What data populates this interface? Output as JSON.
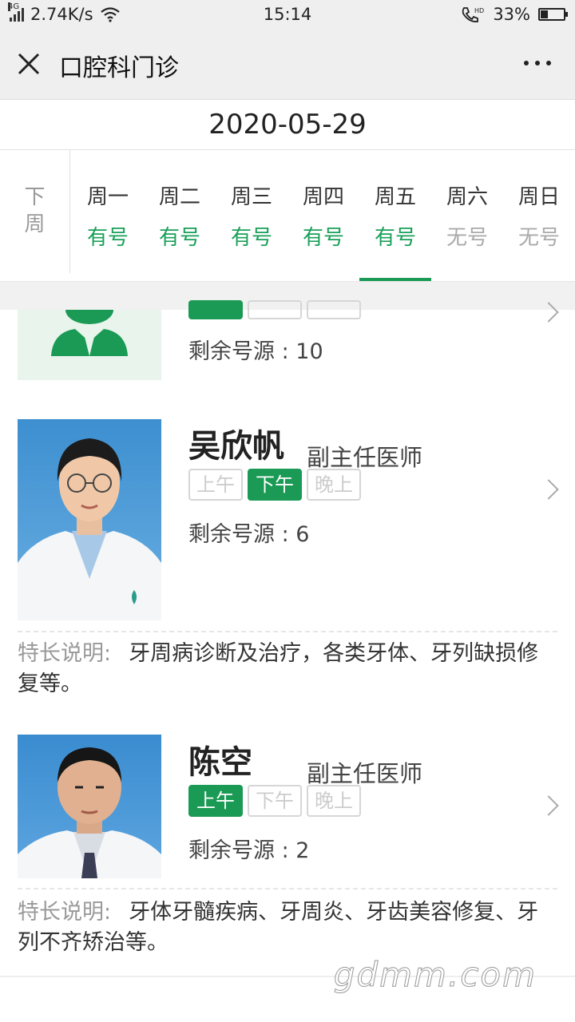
{
  "status_bar": {
    "network_type": "4G",
    "speed": "2.74K/s",
    "time": "15:14",
    "battery": "33%",
    "battery_level": 0.33
  },
  "header": {
    "title": "口腔科门诊"
  },
  "date": "2020-05-29",
  "week": {
    "next_week_label": [
      "下",
      "周"
    ],
    "days": [
      {
        "name": "周一",
        "status": "有号",
        "available": true
      },
      {
        "name": "周二",
        "status": "有号",
        "available": true
      },
      {
        "name": "周三",
        "status": "有号",
        "available": true
      },
      {
        "name": "周四",
        "status": "有号",
        "available": true
      },
      {
        "name": "周五",
        "status": "有号",
        "available": true,
        "selected": true
      },
      {
        "name": "周六",
        "status": "无号",
        "available": false
      },
      {
        "name": "周日",
        "status": "无号",
        "available": false
      }
    ]
  },
  "doctors": [
    {
      "name": "",
      "title": "",
      "remaining_label": "剩余号源 : ",
      "remaining": "10",
      "shifts": [
        {
          "label": "",
          "active": true
        },
        {
          "label": "",
          "active": false
        },
        {
          "label": "",
          "active": false
        }
      ],
      "specialty_label": "",
      "specialty": ""
    },
    {
      "name": "吴欣帆",
      "title": "副主任医师",
      "remaining_label": "剩余号源 : ",
      "remaining": "6",
      "shifts": [
        {
          "label": "上午",
          "active": false
        },
        {
          "label": "下午",
          "active": true
        },
        {
          "label": "晚上",
          "active": false
        }
      ],
      "specialty_label": "特长说明:",
      "specialty": "牙周病诊断及治疗，各类牙体、牙列缺损修复等。"
    },
    {
      "name": "陈空",
      "title": "副主任医师",
      "remaining_label": "剩余号源 : ",
      "remaining": "2",
      "shifts": [
        {
          "label": "上午",
          "active": true
        },
        {
          "label": "下午",
          "active": false
        },
        {
          "label": "晚上",
          "active": false
        }
      ],
      "specialty_label": "特长说明:",
      "specialty": "牙体牙髓疾病、牙周炎、牙齿美容修复、牙列不齐矫治等。"
    }
  ],
  "watermark": "gdmm.com",
  "colors": {
    "accent": "#1a9a55",
    "available": "#1aa05a",
    "unavailable": "#aaaaaa"
  }
}
